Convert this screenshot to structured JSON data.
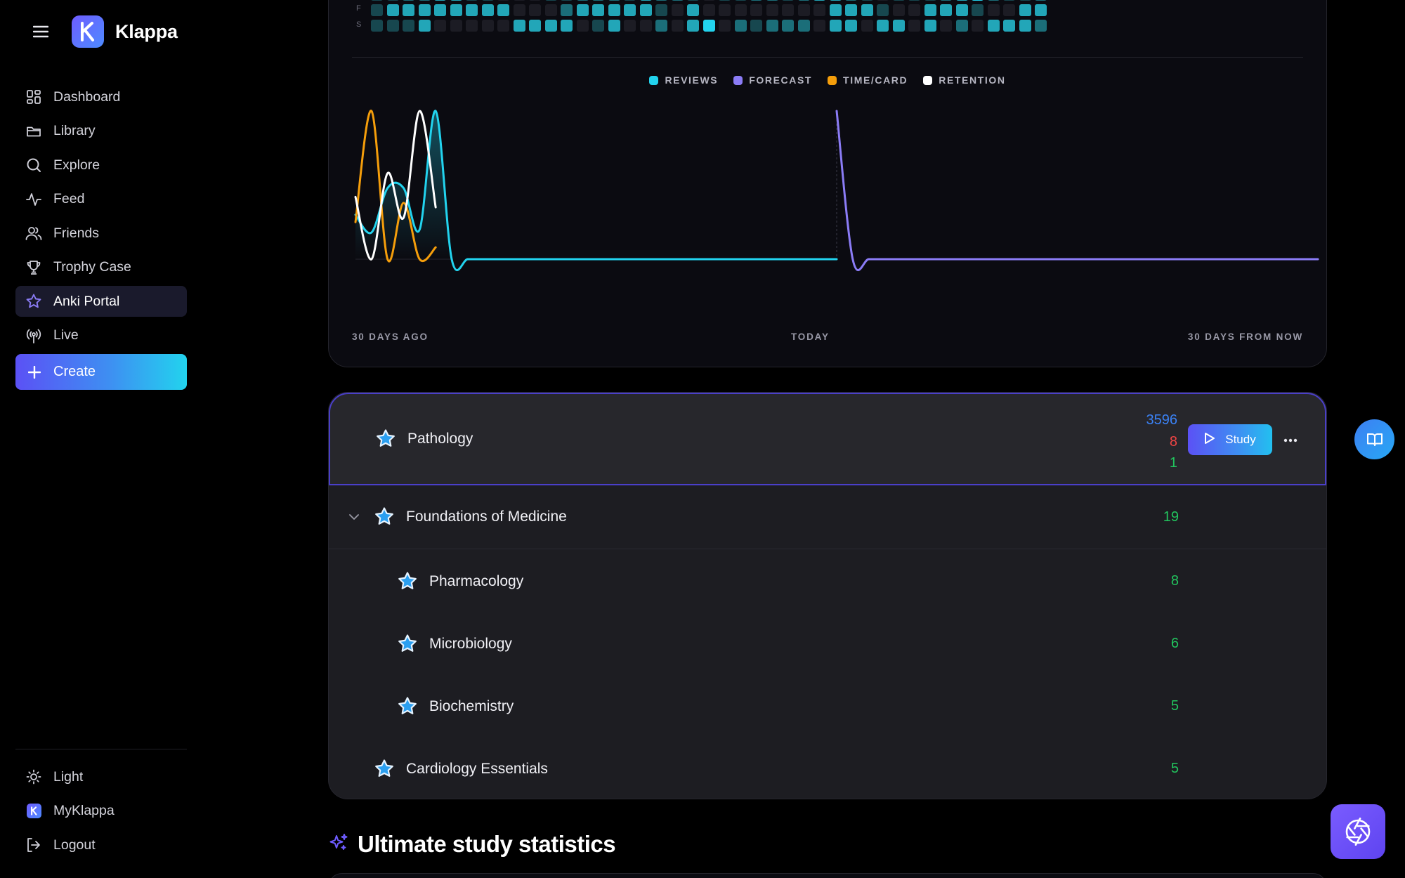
{
  "app": {
    "name": "Klappa"
  },
  "sidebar": {
    "items": [
      {
        "label": "Dashboard",
        "icon": "dashboard-icon"
      },
      {
        "label": "Library",
        "icon": "folder-icon"
      },
      {
        "label": "Explore",
        "icon": "search-icon"
      },
      {
        "label": "Feed",
        "icon": "activity-icon"
      },
      {
        "label": "Friends",
        "icon": "users-icon"
      },
      {
        "label": "Trophy Case",
        "icon": "trophy-icon"
      },
      {
        "label": "Anki Portal",
        "icon": "star-icon",
        "active": true
      },
      {
        "label": "Live",
        "icon": "broadcast-icon"
      }
    ],
    "create_label": "Create",
    "bottom": [
      {
        "label": "Light",
        "icon": "sun-icon"
      },
      {
        "label": "MyKlappa",
        "icon": "klappa-logo-icon"
      },
      {
        "label": "Logout",
        "icon": "logout-icon"
      }
    ]
  },
  "stats": {
    "day_labels": [
      "F",
      "S"
    ],
    "legend": [
      {
        "label": "REVIEWS",
        "color": "#22d3ee"
      },
      {
        "label": "FORECAST",
        "color": "#8b7cf6"
      },
      {
        "label": "TIME/CARD",
        "color": "#f59e0b"
      },
      {
        "label": "RETENTION",
        "color": "#ffffff"
      }
    ],
    "x_labels": {
      "start": "30 DAYS AGO",
      "mid": "TODAY",
      "end": "30 DAYS FROM NOW"
    }
  },
  "chart_data": {
    "type": "line",
    "x": [
      -30,
      -29,
      -28,
      -27,
      -26,
      -25,
      -24,
      -23,
      -22,
      -21,
      -20,
      -19,
      -18,
      -17,
      -16,
      -15,
      -14,
      -13,
      -12,
      -11,
      -10,
      -9,
      -8,
      -7,
      -6,
      -5,
      -4,
      -3,
      -2,
      -1,
      0,
      1,
      2,
      3,
      4,
      5,
      6,
      7,
      8,
      9,
      10,
      11,
      12,
      13,
      14,
      15,
      16,
      17,
      18,
      19,
      20,
      21,
      22,
      23,
      24,
      25,
      26,
      27,
      28,
      29,
      30
    ],
    "series": [
      {
        "name": "REVIEWS",
        "color": "#22d3ee",
        "values": [
          0.3,
          0.18,
          0.48,
          0.48,
          0.2,
          1.0,
          0.0,
          0.0,
          0.0,
          0.0,
          0.0,
          0.0,
          0.0,
          0.0,
          0.0,
          0.0,
          0.0,
          0.0,
          0.0,
          0.0,
          0.0,
          0.0,
          0.0,
          0.0,
          0.0,
          0.0,
          0.0,
          0.0,
          0.0,
          0.0,
          0.0,
          null,
          null,
          null,
          null,
          null,
          null,
          null,
          null,
          null,
          null,
          null,
          null,
          null,
          null,
          null,
          null,
          null,
          null,
          null,
          null,
          null,
          null,
          null,
          null,
          null,
          null,
          null,
          null,
          null,
          null
        ]
      },
      {
        "name": "FORECAST",
        "color": "#8b7cf6",
        "values": [
          null,
          null,
          null,
          null,
          null,
          null,
          null,
          null,
          null,
          null,
          null,
          null,
          null,
          null,
          null,
          null,
          null,
          null,
          null,
          null,
          null,
          null,
          null,
          null,
          null,
          null,
          null,
          null,
          null,
          null,
          1.0,
          0.0,
          0.0,
          0.0,
          0.0,
          0.0,
          0.0,
          0.0,
          0.0,
          0.0,
          0.0,
          0.0,
          0.0,
          0.0,
          0.0,
          0.0,
          0.0,
          0.0,
          0.0,
          0.0,
          0.0,
          0.0,
          0.0,
          0.0,
          0.0,
          0.0,
          0.0,
          0.0,
          0.0,
          0.0,
          0.0
        ]
      },
      {
        "name": "TIME/CARD",
        "color": "#f59e0b",
        "values": [
          0.25,
          1.0,
          0.0,
          0.38,
          0.0,
          0.08,
          null,
          null,
          null,
          null,
          null,
          null,
          null,
          null,
          null,
          null,
          null,
          null,
          null,
          null,
          null,
          null,
          null,
          null,
          null,
          null,
          null,
          null,
          null,
          null,
          null,
          null,
          null,
          null,
          null,
          null,
          null,
          null,
          null,
          null,
          null,
          null,
          null,
          null,
          null,
          null,
          null,
          null,
          null,
          null,
          null,
          null,
          null,
          null,
          null,
          null,
          null,
          null,
          null,
          null,
          null
        ]
      },
      {
        "name": "RETENTION",
        "color": "#ffffff",
        "values": [
          0.42,
          0.0,
          0.58,
          0.28,
          1.0,
          0.35,
          null,
          null,
          null,
          null,
          null,
          null,
          null,
          null,
          null,
          null,
          null,
          null,
          null,
          null,
          null,
          null,
          null,
          null,
          null,
          null,
          null,
          null,
          null,
          null,
          null,
          null,
          null,
          null,
          null,
          null,
          null,
          null,
          null,
          null,
          null,
          null,
          null,
          null,
          null,
          null,
          null,
          null,
          null,
          null,
          null,
          null,
          null,
          null,
          null,
          null,
          null,
          null,
          null,
          null,
          null
        ]
      }
    ],
    "ylim": [
      0,
      1
    ],
    "grid": false
  },
  "decks": {
    "selected": {
      "name": "Pathology",
      "counts": {
        "blue": "3596",
        "red": "8",
        "green": "1"
      },
      "study_label": "Study"
    },
    "rows": [
      {
        "name": "Foundations of Medicine",
        "count": "19",
        "expanded": true
      },
      {
        "name": "Pharmacology",
        "count": "8"
      },
      {
        "name": "Microbiology",
        "count": "6"
      },
      {
        "name": "Biochemistry",
        "count": "5"
      },
      {
        "name": "Cardiology Essentials",
        "count": "5"
      }
    ]
  },
  "section": {
    "title": "Ultimate study statistics"
  }
}
